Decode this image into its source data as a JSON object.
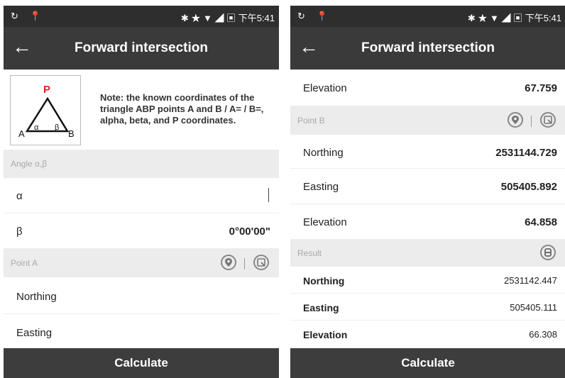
{
  "colors": {
    "appbar": "#3a3a3a",
    "statusbar": "#2e2e2e",
    "section": "#ececec",
    "calc": "#3d3d3d",
    "point_p": "#e02020"
  },
  "status_bar": {
    "left_icons": "↻ 📍",
    "right_icons": "✱ ★ ▼ ◢ ▣",
    "time": "下午5:41"
  },
  "left": {
    "title": "Forward intersection",
    "diagram": {
      "p": "P",
      "a": "A",
      "b": "B",
      "alpha": "α",
      "beta": "β"
    },
    "note": "Note: the known coordinates of the triangle ABP points A and B / A= / B=, alpha, beta, and P coordinates.",
    "angle_section": "Angle α,β",
    "alpha_label": "α",
    "beta_label": "β",
    "beta_value": "0°00'00\"",
    "point_a_section": "Point A",
    "northing_label": "Northing",
    "easting_label": "Easting",
    "calculate": "Calculate"
  },
  "right": {
    "title": "Forward intersection",
    "elevation_label": "Elevation",
    "elevation_value": "67.759",
    "point_b_section": "Point B",
    "b_northing_label": "Northing",
    "b_northing_value": "2531144.729",
    "b_easting_label": "Easting",
    "b_easting_value": "505405.892",
    "b_elevation_label": "Elevation",
    "b_elevation_value": "64.858",
    "result_section": "Result",
    "r_northing_label": "Northing",
    "r_northing_value": "2531142.447",
    "r_easting_label": "Easting",
    "r_easting_value": "505405.111",
    "r_elevation_label": "Elevation",
    "r_elevation_value": "66.308",
    "calculate": "Calculate"
  }
}
